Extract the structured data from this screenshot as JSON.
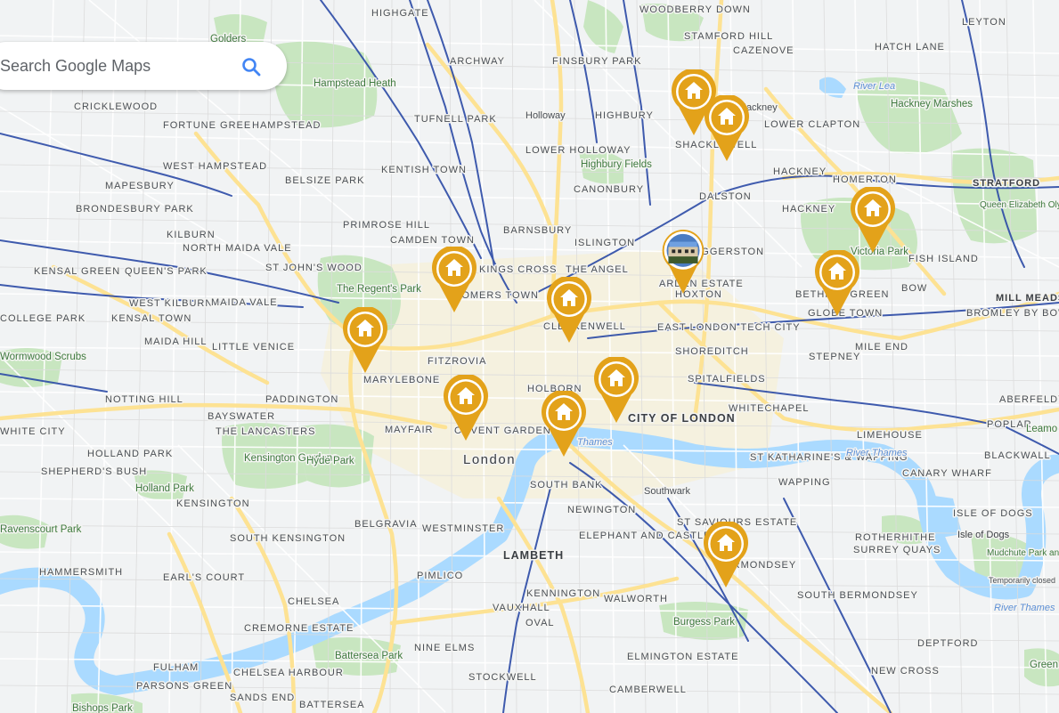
{
  "search": {
    "placeholder": "Search Google Maps",
    "value": ""
  },
  "colors": {
    "pin": "#E3A21A",
    "pin_inner": "#ffffff",
    "water": "#aadaff",
    "park": "#c8e6c0",
    "land": "#f1f3f4",
    "major_road": "#fde293",
    "rail": "#2b4aa6"
  },
  "icons": {
    "pin": "house-icon",
    "search": "search-icon"
  },
  "labels": {
    "highgate": "HIGHGATE",
    "golders": "Golders",
    "hampstead_heath": "Hampstead Heath",
    "archway": "ARCHWAY",
    "finsbury_park": "FINSBURY PARK",
    "woodberry_down": "WOODBERRY DOWN",
    "stamford_hill": "STAMFORD HILL",
    "cazenove": "CAZENOVE",
    "hatch_lane": "HATCH LANE",
    "leyton": "LEYTON",
    "cricklewood": "CRICKLEWOOD",
    "fortune_green": "FORTUNE GREEN",
    "hampstead": "HAMPSTEAD",
    "tufnell_park": "TUFNELL PARK",
    "holloway": "Holloway",
    "highbury": "HIGHBURY",
    "hackney": "Hackney",
    "lower_clapton": "LOWER CLAPTON",
    "hackney_marshes": "Hackney Marshes",
    "river_lea": "River Lea",
    "lower_holloway": "LOWER HOLLOWAY",
    "shacklewell": "SHACKLEWELL",
    "kentish_town": "KENTISH TOWN",
    "highbury_fields": "Highbury Fields",
    "west_hampstead": "WEST HAMPSTEAD",
    "mapesbury": "MAPESBURY",
    "belsize_park": "BELSIZE PARK",
    "canonbury": "CANONBURY",
    "dalston": "DALSTON",
    "hackney_central": "HACKNEY",
    "homerton": "HOMERTON",
    "stratford": "STRATFORD",
    "brondesbury_park": "BRONDESBURY PARK",
    "primrose_hill": "PRIMROSE HILL",
    "barnsbury": "BARNSBURY",
    "hackney2": "HACKNEY",
    "qe_olympic_park": "Queen Elizabeth Olympic Park",
    "kilburn": "KILBURN",
    "camden_town": "CAMDEN TOWN",
    "islington": "ISLINGTON",
    "haggerston": "HAGGERSTON",
    "victoria_park": "Victoria Park",
    "north_maida_vale": "NORTH MAIDA VALE",
    "fish_island": "FISH ISLAND",
    "kensal_green": "KENSAL GREEN",
    "queens_park": "QUEEN'S PARK",
    "st_johns_wood": "ST JOHN'S WOOD",
    "kings_cross": "KINGS CROSS",
    "the_angel": "THE ANGEL",
    "arden_estate": "ARDEN ESTATE",
    "regents_park": "The Regent's Park",
    "somers_town": "SOMERS TOWN",
    "hoxton": "HOXTON",
    "bethnal_green": "BETHNAL GREEN",
    "bow": "BOW",
    "mill_meads": "MILL MEADS",
    "west_kilburn": "WEST KILBURN",
    "maida_vale": "MAIDA VALE",
    "globe_town": "GLOBE TOWN",
    "bromley_by_bow": "BROMLEY BY BOW",
    "kensal_town": "KENSAL TOWN",
    "clerkenwell": "CLERKENWELL",
    "east_london_tech_city": "EAST LONDON TECH CITY",
    "college_park": "COLLEGE PARK",
    "maida_hill": "MAIDA HILL",
    "little_venice": "LITTLE VENICE",
    "mile_end": "MILE END",
    "shoreditch": "SHOREDITCH",
    "wormwood_scrubs": "Wormwood Scrubs",
    "fitzrovia": "FITZROVIA",
    "stepney": "STEPNEY",
    "marylebone": "MARYLEBONE",
    "spitalfields": "SPITALFIELDS",
    "notting_hill": "NOTTING HILL",
    "paddington": "PADDINGTON",
    "holborn": "HOLBORN",
    "aberfeldy_village": "ABERFELDY VILLAGE",
    "whitechapel": "WHITECHAPEL",
    "bayswater": "BAYSWATER",
    "city_of_london": "CITY OF LONDON",
    "poplar": "POPLAR",
    "white_city": "WHITE CITY",
    "the_lancasters": "THE LANCASTERS",
    "mayfair": "MAYFAIR",
    "covent_garden": "COVENT GARDEN",
    "limehouse": "LIMEHOUSE",
    "leamouth": "Leamo",
    "holland_park_area": "HOLLAND PARK",
    "kensington_gardens": "Kensington Gardens",
    "hyde_park": "Hyde Park",
    "london": "London",
    "thames": "Thames",
    "st_katharines": "ST KATHARINE'S & WAPPING",
    "blackwall": "BLACKWALL",
    "shepherds_bush": "SHEPHERD'S BUSH",
    "holland_park": "Holland Park",
    "south_bank": "SOUTH BANK",
    "southwark": "Southwark",
    "wapping": "WAPPING",
    "canary_wharf": "CANARY WHARF",
    "kensington": "KENSINGTON",
    "newington": "NEWINGTON",
    "river_thames": "River Thames",
    "belgravia": "BELGRAVIA",
    "westminster": "WESTMINSTER",
    "st_saviours_estate": "ST SAVIOURS ESTATE",
    "isle_of_dogs_caps": "ISLE OF DOGS",
    "ravenscourt_park": "Ravenscourt Park",
    "south_kensington": "SOUTH KENSINGTON",
    "elephant_and_castle": "ELEPHANT AND CASTLE",
    "rotherhithe": "ROTHERHITHE",
    "isle_of_dogs": "Isle of Dogs",
    "hammersmith": "HAMMERSMITH",
    "lambeth": "LAMBETH",
    "bermondsey": "BERMONDSEY",
    "surrey_quays": "SURREY QUAYS",
    "mudchute": "Mudchute Park and Farm",
    "temporarily_closed": "Temporarily closed",
    "earls_court": "EARL'S COURT",
    "pimlico": "PIMLICO",
    "chelsea": "CHELSEA",
    "kennington": "KENNINGTON",
    "walworth": "WALWORTH",
    "south_bermondsey": "SOUTH BERMONDSEY",
    "vauxhall": "VAUXHALL",
    "oval": "OVAL",
    "burgess_park": "Burgess Park",
    "cremorne_estate": "CREMORNE ESTATE",
    "nine_elms": "NINE ELMS",
    "deptford": "DEPTFORD",
    "greenwich": "Green",
    "battersea_park": "Battersea Park",
    "elmington_estate": "ELMINGTON ESTATE",
    "fulham": "FULHAM",
    "chelsea_harbour": "CHELSEA HARBOUR",
    "stockwell": "STOCKWELL",
    "new_cross": "NEW CROSS",
    "parsons_green": "PARSONS GREEN",
    "sands_end": "SANDS END",
    "camberwell": "CAMBERWELL",
    "bishops_park": "Bishops Park",
    "battersea": "BATTERSEA"
  },
  "pins": [
    {
      "name": "property-pin-1"
    },
    {
      "name": "property-pin-2"
    },
    {
      "name": "property-pin-3"
    },
    {
      "name": "property-pin-4"
    },
    {
      "name": "property-pin-5"
    },
    {
      "name": "property-pin-6"
    },
    {
      "name": "property-pin-7"
    },
    {
      "name": "property-pin-8"
    },
    {
      "name": "property-pin-9"
    },
    {
      "name": "property-pin-10"
    },
    {
      "name": "property-pin-11"
    },
    {
      "name": "property-pin-12"
    }
  ],
  "photo_pin": {
    "name": "property-photo-pin"
  }
}
